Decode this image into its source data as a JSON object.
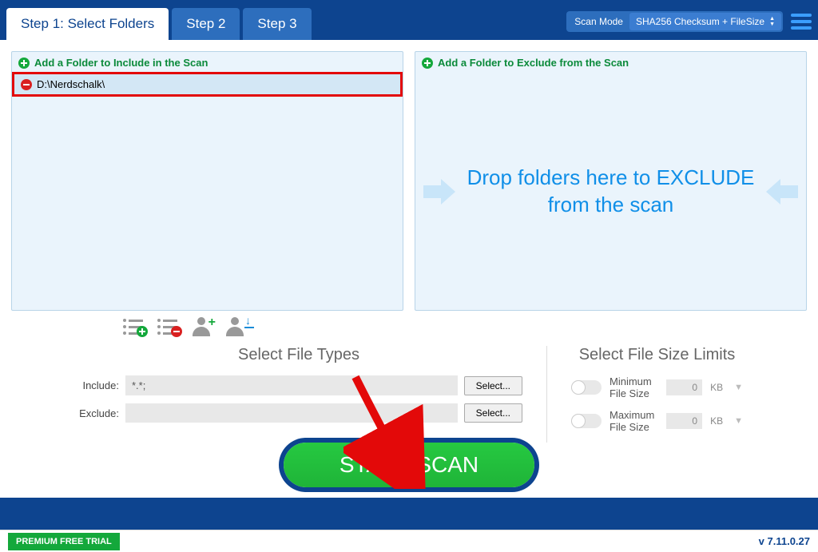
{
  "tabs": {
    "step1": "Step 1: Select Folders",
    "step2": "Step 2",
    "step3": "Step 3"
  },
  "scanMode": {
    "label": "Scan Mode",
    "value": "SHA256 Checksum + FileSize"
  },
  "panels": {
    "include": {
      "header": "Add a Folder to Include in the Scan",
      "folders": [
        {
          "path": "D:\\Nerdschalk\\"
        }
      ]
    },
    "exclude": {
      "header": "Add a Folder to Exclude from the Scan",
      "dropText": "Drop folders here to EXCLUDE from the scan"
    }
  },
  "fileTypes": {
    "title": "Select File Types",
    "includeLabel": "Include:",
    "includeValue": "*.*;",
    "excludeLabel": "Exclude:",
    "excludeValue": "",
    "selectBtn": "Select..."
  },
  "sizeLimits": {
    "title": "Select File Size Limits",
    "minLabel": "Minimum File Size",
    "maxLabel": "Maximum File Size",
    "minVal": "0",
    "maxVal": "0",
    "unit": "KB"
  },
  "startBtn": "START SCAN",
  "trial": "PREMIUM FREE TRIAL",
  "version": "v 7.11.0.27"
}
